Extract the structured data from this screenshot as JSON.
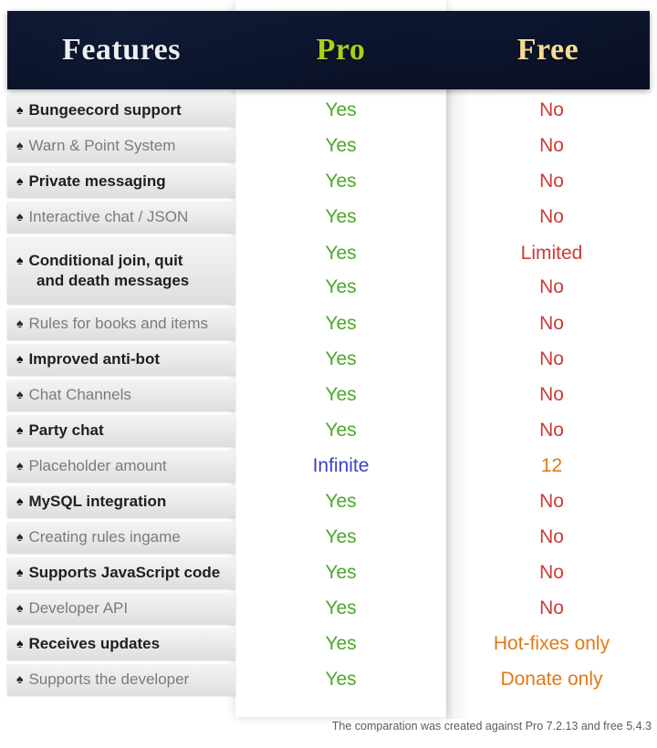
{
  "header": {
    "features_label": "Features",
    "pro_label": "Pro",
    "free_label": "Free",
    "bar_color": "#0a1127",
    "features_color": "#eceef2",
    "pro_color": "#a9d117",
    "free_color": "#f6dc93"
  },
  "bullet_icon": "♠",
  "colors": {
    "yes": "#4aa829",
    "no": "#cc3b38",
    "infinite": "#3a43c8",
    "orange": "#e07a15",
    "feature_dark": "#1f1f1f",
    "feature_light": "#7b7b7b"
  },
  "rows": [
    {
      "feature": "Bungeecord support",
      "feature2": "",
      "style": "dark",
      "pro": "Yes",
      "pro_class": "v-yes",
      "free": "No",
      "free_class": "v-no"
    },
    {
      "feature": "Warn & Point System",
      "feature2": "",
      "style": "light",
      "pro": "Yes",
      "pro_class": "v-yes",
      "free": "No",
      "free_class": "v-no"
    },
    {
      "feature": "Private messaging",
      "feature2": "",
      "style": "dark",
      "pro": "Yes",
      "pro_class": "v-yes",
      "free": "No",
      "free_class": "v-no"
    },
    {
      "feature": "Interactive chat / JSON",
      "feature2": "",
      "style": "light",
      "pro": "Yes",
      "pro_class": "v-yes",
      "free": "No",
      "free_class": "v-no"
    },
    {
      "feature": "Conditional join, quit",
      "feature2": "and death messages",
      "style": "dark",
      "pro": "Yes",
      "pro_class": "v-yes",
      "free": "Limited",
      "free_class": "v-limited",
      "pro2": "Yes",
      "pro2_class": "v-yes",
      "free2": "No",
      "free2_class": "v-no"
    },
    {
      "feature": "Rules for books and items",
      "feature2": "",
      "style": "light",
      "pro": "Yes",
      "pro_class": "v-yes",
      "free": "No",
      "free_class": "v-no"
    },
    {
      "feature": "Improved anti-bot",
      "feature2": "",
      "style": "dark",
      "pro": "Yes",
      "pro_class": "v-yes",
      "free": "No",
      "free_class": "v-no"
    },
    {
      "feature": "Chat Channels",
      "feature2": "",
      "style": "light",
      "pro": "Yes",
      "pro_class": "v-yes",
      "free": "No",
      "free_class": "v-no"
    },
    {
      "feature": "Party chat",
      "feature2": "",
      "style": "dark",
      "pro": "Yes",
      "pro_class": "v-yes",
      "free": "No",
      "free_class": "v-no"
    },
    {
      "feature": "Placeholder amount",
      "feature2": "",
      "style": "light",
      "pro": "Infinite",
      "pro_class": "v-infinite",
      "free": "12",
      "free_class": "v-orange"
    },
    {
      "feature": "MySQL integration",
      "feature2": "",
      "style": "dark",
      "pro": "Yes",
      "pro_class": "v-yes",
      "free": "No",
      "free_class": "v-no"
    },
    {
      "feature": "Creating rules ingame",
      "feature2": "",
      "style": "light",
      "pro": "Yes",
      "pro_class": "v-yes",
      "free": "No",
      "free_class": "v-no"
    },
    {
      "feature": "Supports JavaScript code",
      "feature2": "",
      "style": "dark",
      "pro": "Yes",
      "pro_class": "v-yes",
      "free": "No",
      "free_class": "v-no"
    },
    {
      "feature": "Developer API",
      "feature2": "",
      "style": "light",
      "pro": "Yes",
      "pro_class": "v-yes",
      "free": "No",
      "free_class": "v-no"
    },
    {
      "feature": "Receives updates",
      "feature2": "",
      "style": "dark",
      "pro": "Yes",
      "pro_class": "v-yes",
      "free": "Hot-fixes only",
      "free_class": "v-orange"
    },
    {
      "feature": "Supports the developer",
      "feature2": "",
      "style": "light",
      "pro": "Yes",
      "pro_class": "v-yes",
      "free": "Donate only",
      "free_class": "v-orange"
    }
  ],
  "footnote": "The comparation was created against Pro 7.2.13 and free 5.4.3"
}
